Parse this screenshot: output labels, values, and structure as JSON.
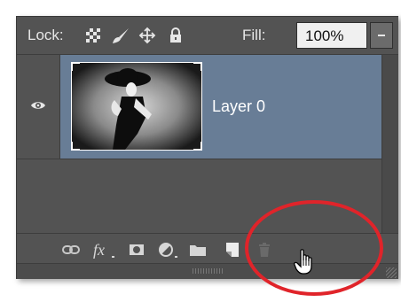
{
  "lock_bar": {
    "label": "Lock:",
    "icons": [
      "lock-transparent-pixels-icon",
      "lock-image-pixels-icon",
      "lock-position-icon",
      "lock-all-icon"
    ],
    "fill_label": "Fill:",
    "fill_value": "100%"
  },
  "layer": {
    "name": "Layer 0",
    "visibility_icon": "eye-icon",
    "selected": true
  },
  "toolbar": {
    "icons": [
      "link-layers-icon",
      "fx-icon",
      "layer-mask-icon",
      "adjustment-layer-icon",
      "new-group-icon",
      "new-layer-icon",
      "delete-layer-icon"
    ],
    "fx_label": "fx"
  },
  "colors": {
    "panel_bg": "#535353",
    "selected_row": "#687d96",
    "highlight_circle": "#e0242a"
  }
}
